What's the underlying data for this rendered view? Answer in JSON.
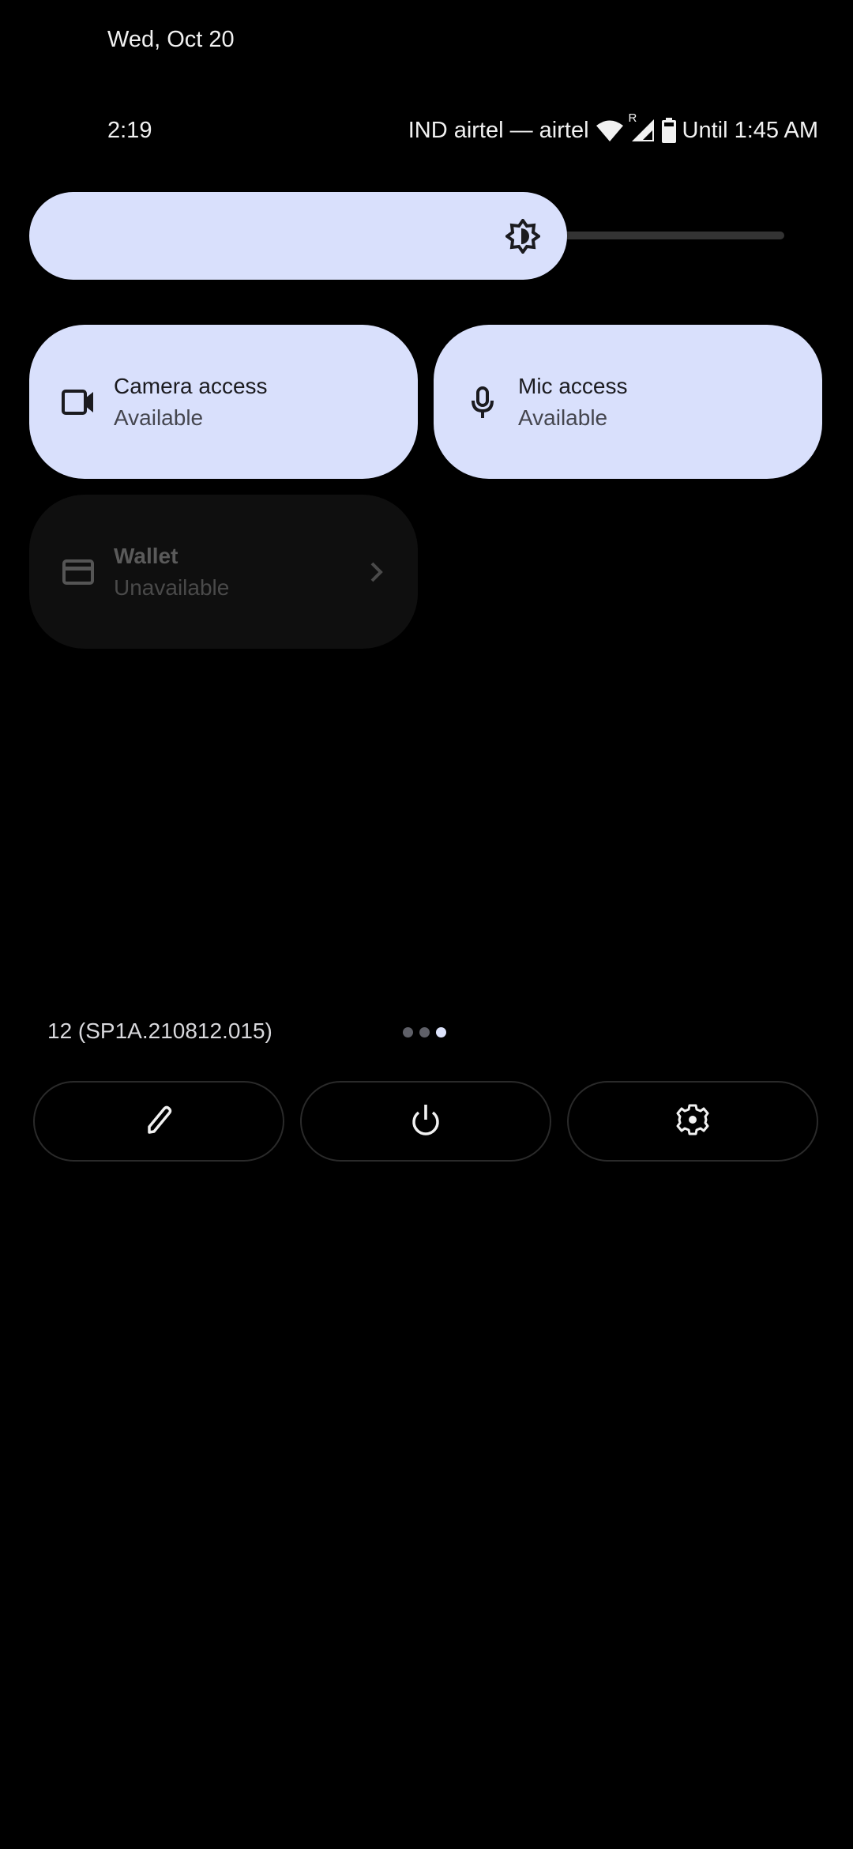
{
  "header": {
    "date": "Wed, Oct 20",
    "time": "2:19",
    "carrier": "IND airtel — airtel",
    "roaming_indicator": "R",
    "battery_text": "Until 1:45 AM",
    "icons": [
      "wifi-icon",
      "signal-roaming-icon",
      "battery-icon"
    ]
  },
  "brightness": {
    "icon": "brightness-auto-icon",
    "level_percent": 64
  },
  "tiles": [
    {
      "icon": "videocam-icon",
      "label": "Camera access",
      "status": "Available",
      "state": "active"
    },
    {
      "icon": "mic-icon",
      "label": "Mic access",
      "status": "Available",
      "state": "active"
    },
    {
      "icon": "credit-card-icon",
      "label": "Wallet",
      "status": "Unavailable",
      "state": "unavailable",
      "trailing_icon": "chevron-right-icon"
    }
  ],
  "footer": {
    "build": "12 (SP1A.210812.015)",
    "page_indicator": {
      "pages": 3,
      "current": 3
    },
    "buttons": [
      {
        "icon": "edit-pencil-icon",
        "action": "Edit"
      },
      {
        "icon": "power-icon",
        "action": "Power"
      },
      {
        "icon": "settings-gear-icon",
        "action": "Settings"
      }
    ]
  },
  "colors": {
    "tile_active_bg": "#d9e0fc",
    "tile_inactive_bg": "#0f0f0f",
    "background": "#000000",
    "page_dot_active": "#dde3fb",
    "page_dot_inactive": "#5f6068"
  }
}
